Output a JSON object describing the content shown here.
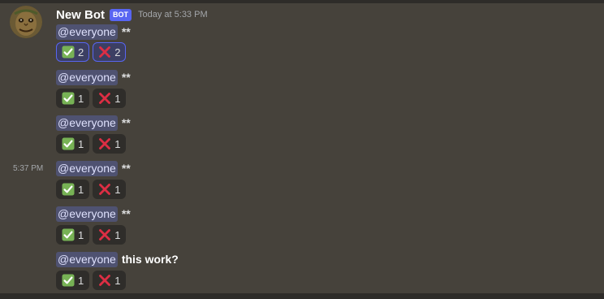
{
  "message": {
    "author": "New Bot",
    "badge": "BOT",
    "timestamp": "Today at 5:33 PM",
    "side_time": "5:37 PM"
  },
  "colors": {
    "background": "#46423b",
    "mention_bg": "#4f5271",
    "badge_bg": "#5865f2",
    "check_green": "#77b255",
    "cross_red": "#dd2e44"
  },
  "icons": {
    "check": "white-check-mark-emoji",
    "cross": "cross-mark-emoji"
  },
  "lines": [
    {
      "mention": "@everyone",
      "text": "**",
      "check_count": "2",
      "cross_count": "2"
    },
    {
      "mention": "@everyone",
      "text": "**",
      "check_count": "1",
      "cross_count": "1"
    },
    {
      "mention": "@everyone",
      "text": "**",
      "check_count": "1",
      "cross_count": "1"
    },
    {
      "mention": "@everyone",
      "text": "**",
      "check_count": "1",
      "cross_count": "1"
    },
    {
      "mention": "@everyone",
      "text": "**",
      "check_count": "1",
      "cross_count": "1"
    },
    {
      "mention": "@everyone",
      "text": "this work?",
      "check_count": "1",
      "cross_count": "1"
    }
  ]
}
